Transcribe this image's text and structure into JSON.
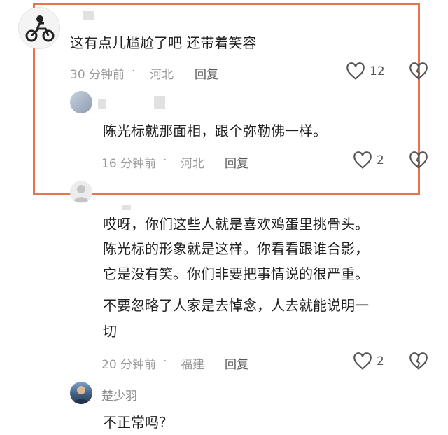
{
  "comments": [
    {
      "text": "这有点儿尴尬了吧 还带着笑容",
      "time": "30 分钟前",
      "location": "河北",
      "reply": "回复",
      "likes": "12"
    },
    {
      "text": "陈光标就那面相，跟个弥勒佛一样。",
      "time": "16 分钟前",
      "location": "河北",
      "reply": "回复",
      "likes": "2"
    },
    {
      "lines": [
        "哎呀，你们这些人就是喜欢鸡蛋里挑骨头。",
        "陈光标的形象就是这样。你看看跟谁合影，",
        "它是没有笑。你们非要把事情说的很严重。",
        "不要忽略了人家是去悼念，人去就能说明一",
        "切"
      ],
      "time": "20 分钟前",
      "location": "福建",
      "reply": "回复",
      "likes": "2"
    },
    {
      "name": "楚少羽",
      "text": "不正常吗?"
    }
  ],
  "separator": " · ",
  "colors": {
    "highlight": "#e8734e",
    "meta": "#9a9a9a"
  }
}
